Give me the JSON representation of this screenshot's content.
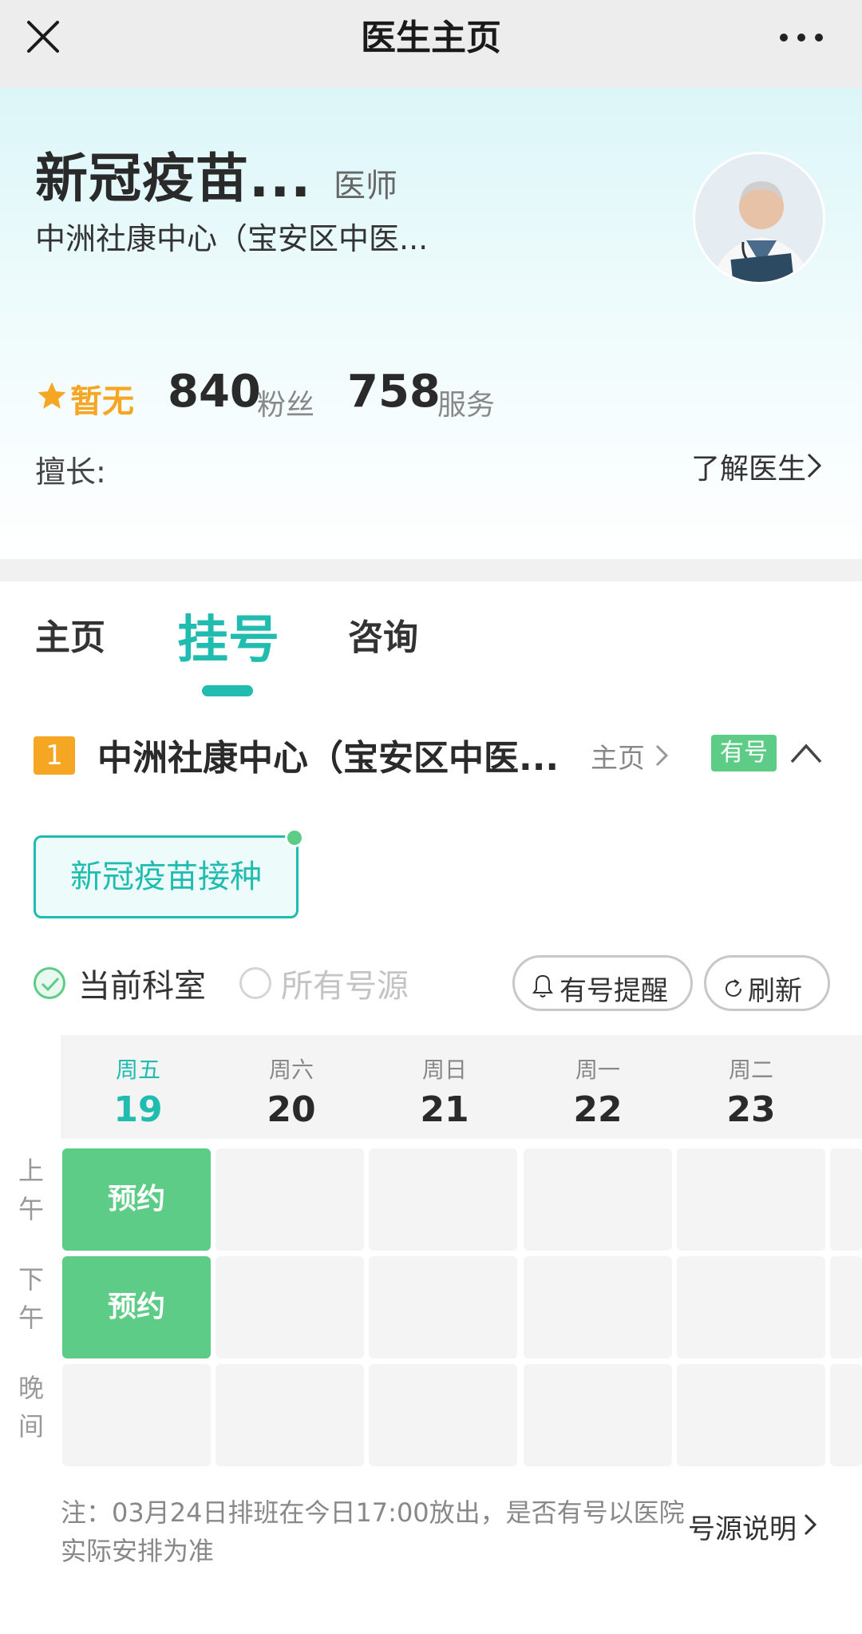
{
  "nav": {
    "title": "医生主页"
  },
  "doctor": {
    "name": "新冠疫苗...",
    "title": "医师",
    "hospital": "中洲社康中心（宝安区中医...",
    "rating": "暂无",
    "fans_count": "840",
    "fans_label": "粉丝",
    "service_count": "758",
    "service_label": "服务",
    "specialty_label": "擅长:",
    "know_more": "了解医生"
  },
  "tabs": [
    {
      "label": "主页"
    },
    {
      "label": "挂号"
    },
    {
      "label": "咨询"
    }
  ],
  "hospital_row": {
    "index": "1",
    "name": "中洲社康中心（宝安区中医...",
    "home_link": "主页",
    "badge": "有号"
  },
  "service_chip": "新冠疫苗接种",
  "filters": {
    "current_dept": "当前科室",
    "all_sources": "所有号源",
    "remind_btn": "有号提醒",
    "refresh_btn": "刷新"
  },
  "schedule": {
    "days": [
      {
        "weekday": "周五",
        "date": "19"
      },
      {
        "weekday": "周六",
        "date": "20"
      },
      {
        "weekday": "周日",
        "date": "21"
      },
      {
        "weekday": "周一",
        "date": "22"
      },
      {
        "weekday": "周二",
        "date": "23"
      }
    ],
    "periods": [
      "上\n午",
      "下\n午",
      "晚\n间"
    ],
    "book_label": "预约"
  },
  "note": "注：03月24日排班在今日17:00放出，是否有号以医院实际安排为准",
  "note_link": "号源说明",
  "colors": {
    "accent": "#20bcb0",
    "green": "#5ccc86",
    "orange": "#f5a623"
  }
}
